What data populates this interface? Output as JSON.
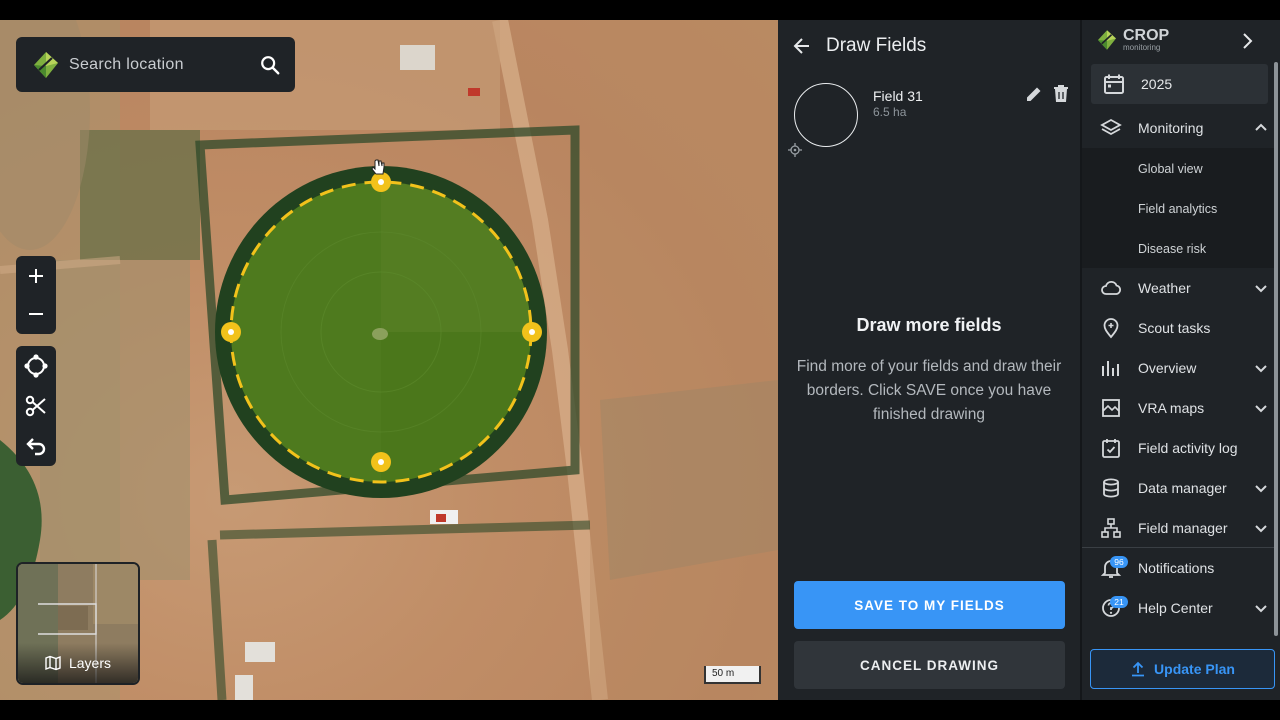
{
  "map": {
    "search": {
      "placeholder": "Search location",
      "icon": "search-icon"
    },
    "tools": [
      "zoom-in-icon",
      "zoom-out-icon",
      "draw-polygon-icon",
      "cut-icon",
      "undo-icon"
    ],
    "layers_label": "Layers",
    "scale_label": "50 m"
  },
  "draw_panel": {
    "title": "Draw Fields",
    "field": {
      "name": "Field 31",
      "area": "6.5 ha"
    },
    "info_title": "Draw more fields",
    "info_text": "Find more of your fields and draw their borders. Click SAVE once you have finished drawing",
    "save_label": "SAVE TO MY FIELDS",
    "cancel_label": "CANCEL DRAWING"
  },
  "sidebar": {
    "brand_name": "CROP",
    "brand_sub": "monitoring",
    "year": "2025",
    "monitoring": {
      "label": "Monitoring",
      "sub_items": [
        "Global view",
        "Field analytics",
        "Disease risk"
      ]
    },
    "items": [
      {
        "label": "Weather",
        "icon": "cloud-icon",
        "has_chevron": true
      },
      {
        "label": "Scout tasks",
        "icon": "map-pin-icon",
        "has_chevron": false
      },
      {
        "label": "Overview",
        "icon": "bar-chart-icon",
        "has_chevron": true
      },
      {
        "label": "VRA maps",
        "icon": "vra-map-icon",
        "has_chevron": true
      },
      {
        "label": "Field activity log",
        "icon": "calendar-check-icon",
        "has_chevron": false
      },
      {
        "label": "Data manager",
        "icon": "database-icon",
        "has_chevron": true
      },
      {
        "label": "Field manager",
        "icon": "hierarchy-icon",
        "has_chevron": true
      }
    ],
    "notifications": {
      "label": "Notifications",
      "badge": "96"
    },
    "help": {
      "label": "Help Center",
      "badge": "21"
    },
    "update_label": "Update Plan"
  },
  "colors": {
    "accent": "#3895f6",
    "panel": "#1f2327",
    "field_outline": "#f2c21b",
    "field_fill": "#4e7a1e"
  }
}
